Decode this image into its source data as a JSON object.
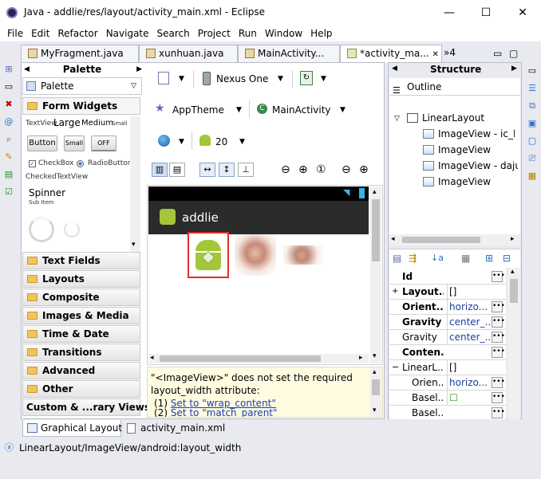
{
  "window": {
    "title": "Java - addlie/res/layout/activity_main.xml - Eclipse",
    "minimize": "—",
    "maximize": "☐",
    "close": "✕"
  },
  "menu": [
    "File",
    "Edit",
    "Refactor",
    "Navigate",
    "Search",
    "Project",
    "Run",
    "Window",
    "Help"
  ],
  "editor_tabs": [
    {
      "label": "MyFragment.java"
    },
    {
      "label": "xunhuan.java"
    },
    {
      "label": "MainActivity..."
    },
    {
      "label": "*activity_ma..."
    },
    {
      "label": "»4"
    }
  ],
  "palette": {
    "header": "Palette",
    "dropdown": "Palette",
    "form_widgets": "Form Widgets",
    "textview_label": "TextView",
    "large": "Large",
    "medium": "Medium",
    "small": "Small",
    "button": "Button",
    "small_button": "Small",
    "toggle": "OFF",
    "checkbox": "CheckBox",
    "radio": "RadioButton",
    "checked_textview": "CheckedTextView",
    "spinner": "Spinner",
    "sub_item": "Sub Item",
    "categories": [
      "Text Fields",
      "Layouts",
      "Composite",
      "Images & Media",
      "Time & Date",
      "Transitions",
      "Advanced",
      "Other",
      "Custom & ...rary Views"
    ]
  },
  "layout_toolbar": {
    "device": "Nexus One",
    "theme": "AppTheme",
    "activity": "MainActivity",
    "api": "20"
  },
  "preview": {
    "app_name": "addlie"
  },
  "message": {
    "text": "\"<ImageView>\" does not set the required layout_width attribute:",
    "fix1_prefix": "(1) ",
    "fix1_link": "Set to \"wrap_content\"",
    "fix2_prefix": "(2) ",
    "fix2_link": "Set to \"match_parent\""
  },
  "bottom_tabs": {
    "graphical": "Graphical Layout",
    "xml": "activity_main.xml"
  },
  "structure": {
    "header": "Structure",
    "outline": "Outline",
    "tree": [
      {
        "label": "LinearLayout"
      },
      {
        "label": "ImageView - ic_la"
      },
      {
        "label": "ImageView"
      },
      {
        "label": "ImageView - daju"
      },
      {
        "label": "ImageView"
      }
    ]
  },
  "properties": [
    {
      "name": "Id",
      "value": "",
      "bold": true,
      "dots": true
    },
    {
      "name": "Layout...",
      "value": "[]",
      "bold": true,
      "dots": false,
      "expand": "+"
    },
    {
      "name": "Orient...",
      "value": "horizo...",
      "bold": true,
      "dots": true
    },
    {
      "name": "Gravity",
      "value": "center_...",
      "bold": true,
      "dots": true
    },
    {
      "name": "Gravity",
      "value": "center_...",
      "bold": false,
      "dots": true
    },
    {
      "name": "Conten...",
      "value": "",
      "bold": true,
      "dots": true
    },
    {
      "name": "LinearL...",
      "value": "[]",
      "bold": false,
      "dots": false,
      "expand": "−"
    },
    {
      "name": "Orien...",
      "value": "horizo...",
      "bold": false,
      "dots": true
    },
    {
      "name": "Basel...",
      "value": "☐",
      "bold": false,
      "dots": true
    },
    {
      "name": "Basel...",
      "value": "",
      "bold": false,
      "dots": true
    }
  ],
  "status": {
    "path": "LinearLayout/ImageView/android:layout_width"
  },
  "colors": {
    "workbench": "#e8eaf0",
    "selection_box": "#e0302a",
    "android_green": "#a4c639"
  }
}
